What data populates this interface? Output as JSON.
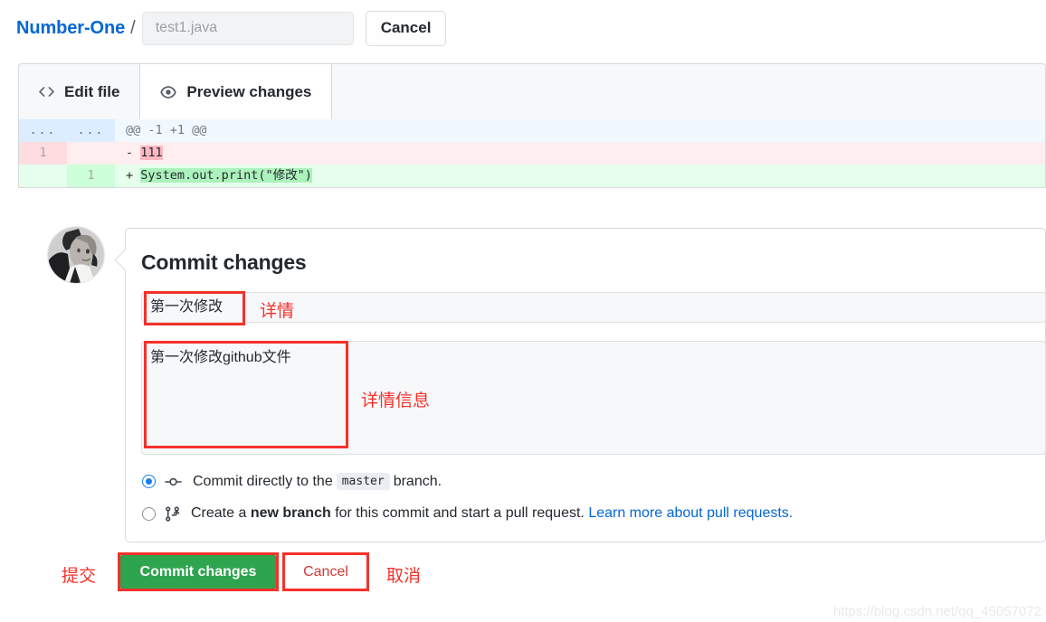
{
  "header": {
    "repo_name": "Number-One",
    "separator": "/",
    "filename_value": "test1.java",
    "cancel_label": "Cancel"
  },
  "tabs": [
    {
      "label": "Edit file",
      "icon": "code-brackets-icon",
      "active": false
    },
    {
      "label": "Preview changes",
      "icon": "eye-icon",
      "active": true
    }
  ],
  "diff": {
    "rows": [
      {
        "type": "hunk",
        "old_line": "...",
        "new_line": "...",
        "sign": "",
        "text": "@@ -1 +1 @@"
      },
      {
        "type": "deletion",
        "old_line": "1",
        "new_line": "",
        "sign": "-",
        "text": "111"
      },
      {
        "type": "addition",
        "old_line": "",
        "new_line": "1",
        "sign": "+",
        "text": "System.out.print(\"修改\")"
      }
    ]
  },
  "commit": {
    "title": "Commit changes",
    "subject_value": "第一次修改",
    "body_value": "第一次修改github文件",
    "options": [
      {
        "id": "commit-directly",
        "icon": "commit-dot-icon",
        "checked": true,
        "prefix": "Commit directly to the",
        "chip": "master",
        "suffix": "branch."
      },
      {
        "id": "create-branch",
        "icon": "branch-fork-icon",
        "checked": false,
        "prefix": "Create a",
        "strong": "new branch",
        "suffix": "for this commit and start a pull request.",
        "link": "Learn more about pull requests."
      }
    ],
    "submit_label": "Commit changes",
    "cancel_label": "Cancel"
  },
  "annotations": {
    "subject_note": "详情",
    "body_note": "详情信息",
    "submit_note": "提交",
    "cancel_note": "取消"
  },
  "watermark": "https://blog.csdn.net/qq_45057072",
  "colors": {
    "link": "#0366d6",
    "accent_green": "#2ea44f",
    "annotation_red": "#f5312a",
    "radio_blue": "#1b7ced"
  }
}
